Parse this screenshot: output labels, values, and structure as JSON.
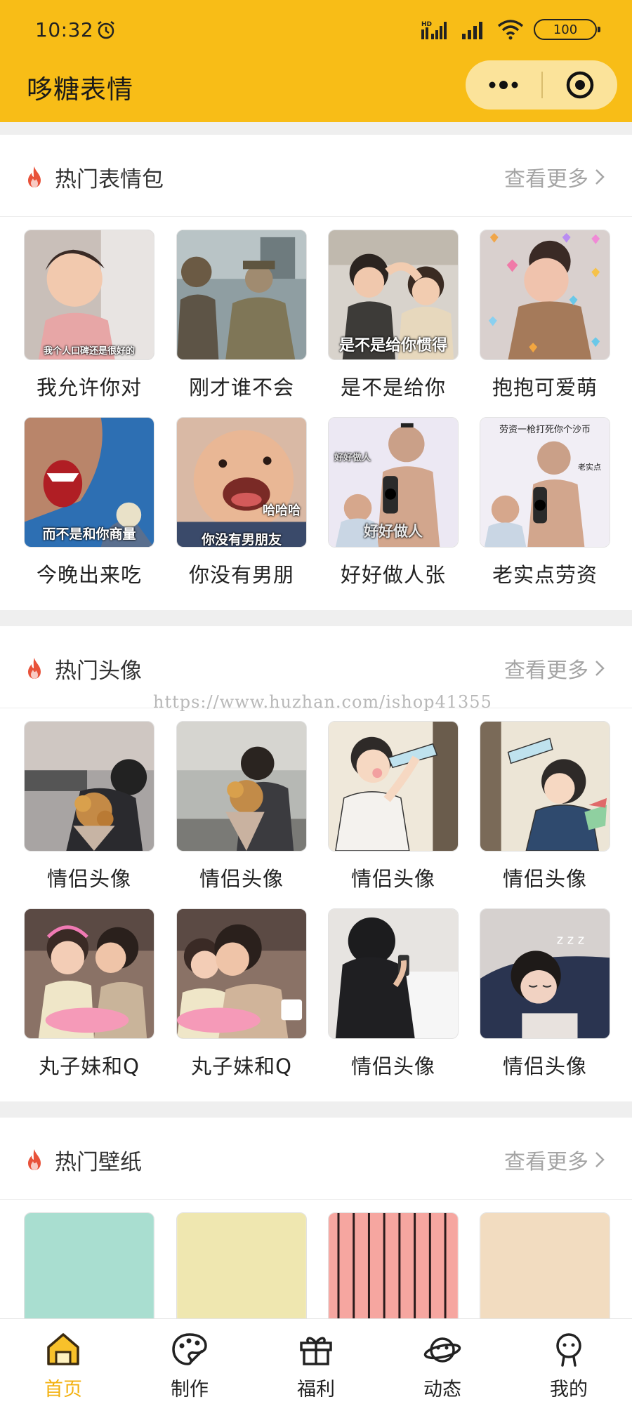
{
  "status_bar": {
    "time": "10:32",
    "battery": "100",
    "network": "HD"
  },
  "header": {
    "title": "哆糖表情",
    "more_icon": "more-dots-icon",
    "close_icon": "target-close-icon"
  },
  "watermark": "https://www.huzhan.com/ishop41355",
  "sections": [
    {
      "title": "热门表情包",
      "more": "查看更多",
      "items": [
        {
          "caption": "我允许你对",
          "overlay": "我个人口碑还是很好的"
        },
        {
          "caption": "刚才谁不会",
          "overlay": ""
        },
        {
          "caption": "是不是给你",
          "overlay": "是不是给你惯得"
        },
        {
          "caption": "抱抱可爱萌",
          "overlay": ""
        },
        {
          "caption": "今晚出来吃",
          "overlay": "而不是和你商量"
        },
        {
          "caption": "你没有男朋",
          "overlay": "你没有男朋友",
          "overlay2": "哈哈哈"
        },
        {
          "caption": "好好做人张",
          "overlay": "好好做人"
        },
        {
          "caption": "老实点劳资",
          "overlay": "劳资一枪打死你个沙币",
          "overlay2": "老实点"
        }
      ]
    },
    {
      "title": "热门头像",
      "more": "查看更多",
      "items": [
        {
          "caption": "情侣头像"
        },
        {
          "caption": "情侣头像"
        },
        {
          "caption": "情侣头像"
        },
        {
          "caption": "情侣头像"
        },
        {
          "caption": "丸子妹和Q"
        },
        {
          "caption": "丸子妹和Q"
        },
        {
          "caption": "情侣头像"
        },
        {
          "caption": "情侣头像"
        }
      ]
    },
    {
      "title": "热门壁纸",
      "more": "查看更多",
      "items": [
        {
          "color": "#a9ded0"
        },
        {
          "color": "#efe7b0"
        },
        {
          "color": "#f6a6a0"
        },
        {
          "color": "#f2dcc0"
        }
      ]
    }
  ],
  "tabbar": [
    {
      "label": "首页",
      "icon": "home-icon",
      "active": true
    },
    {
      "label": "制作",
      "icon": "palette-icon",
      "active": false
    },
    {
      "label": "福利",
      "icon": "gift-icon",
      "active": false
    },
    {
      "label": "动态",
      "icon": "planet-icon",
      "active": false
    },
    {
      "label": "我的",
      "icon": "user-icon",
      "active": false
    }
  ],
  "colors": {
    "brand": "#f8bd17",
    "active_tab": "#f3b10f",
    "fire": "#e8523a"
  }
}
